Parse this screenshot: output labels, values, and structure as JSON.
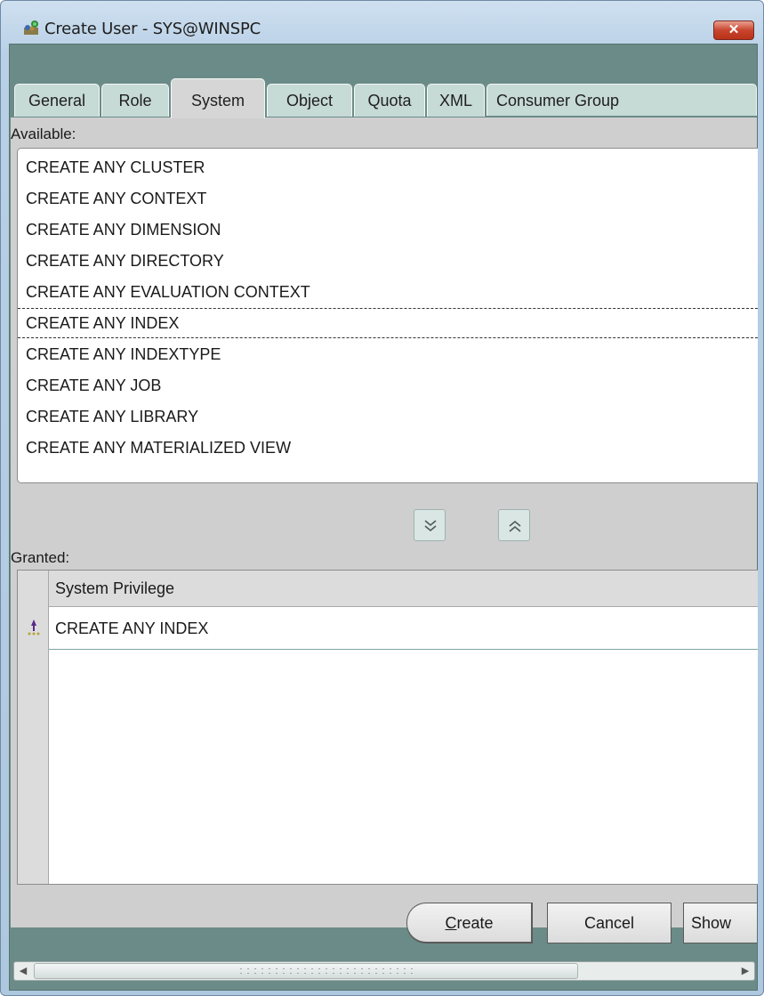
{
  "window": {
    "title": "Create User - SYS@WINSPC",
    "close_icon": "close-x-icon"
  },
  "tabs": [
    {
      "label": "General"
    },
    {
      "label": "Role"
    },
    {
      "label": "System",
      "active": true
    },
    {
      "label": "Object"
    },
    {
      "label": "Quota"
    },
    {
      "label": "XML"
    },
    {
      "label": "Consumer Group"
    }
  ],
  "available": {
    "label": "Available:",
    "items": [
      "CREATE ANY CLUSTER",
      "CREATE ANY CONTEXT",
      "CREATE ANY DIMENSION",
      "CREATE ANY DIRECTORY",
      "CREATE ANY EVALUATION CONTEXT",
      "CREATE ANY INDEX",
      "CREATE ANY INDEXTYPE",
      "CREATE ANY JOB",
      "CREATE ANY LIBRARY",
      "CREATE ANY MATERIALIZED VIEW"
    ],
    "selected": "CREATE ANY INDEX"
  },
  "move_buttons": {
    "down_icon": "chevron-double-down-icon",
    "up_icon": "chevron-double-up-icon"
  },
  "granted": {
    "label": "Granted:",
    "column_header": "System Privilege",
    "rows": [
      "CREATE ANY INDEX"
    ],
    "row_icon": "row-indicator-icon"
  },
  "buttons": {
    "create_prefix": "C",
    "create_rest": "reate",
    "cancel": "Cancel",
    "show": "Show"
  }
}
